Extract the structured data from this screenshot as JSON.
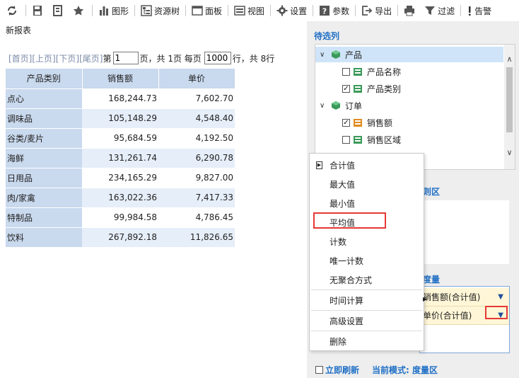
{
  "toolbar": {
    "refresh_icon": "refresh-icon",
    "save_icon": "save-icon",
    "save_as_icon": "save-as-icon",
    "favorite_icon": "star-icon",
    "chart_label": "图形",
    "resource_tree_label": "资源树",
    "panel_label": "面板",
    "view_label": "视图",
    "settings_label": "设置",
    "params_label": "参数",
    "export_label": "导出",
    "print_icon": "print-icon",
    "filter_label": "过滤",
    "alert_label": "告警"
  },
  "report": {
    "title": "新报表"
  },
  "pager": {
    "first": "[首页]",
    "prev": "[上页]",
    "next": "[下页]",
    "last": "[尾页]",
    "page_prefix": "第",
    "page_value": "1",
    "page_suffix": "页，共 1页 每页",
    "page_size_value": "1000",
    "rows_suffix": "行，共 8行"
  },
  "table": {
    "headers": [
      "产品类别",
      "销售额",
      "单价"
    ],
    "rows": [
      [
        "点心",
        "168,244.73",
        "7,602.70"
      ],
      [
        "调味品",
        "105,148.29",
        "4,548.40"
      ],
      [
        "谷类/麦片",
        "95,684.59",
        "4,192.50"
      ],
      [
        "海鲜",
        "131,261.74",
        "6,290.78"
      ],
      [
        "日用品",
        "234,165.29",
        "9,827.00"
      ],
      [
        "肉/家禽",
        "163,022.36",
        "7,417.33"
      ],
      [
        "特制品",
        "99,984.58",
        "4,786.45"
      ],
      [
        "饮料",
        "267,892.18",
        "11,826.65"
      ]
    ]
  },
  "panel": {
    "candidates_title": "待选列",
    "tree": [
      {
        "label": "产品",
        "expanded": true,
        "selected": true
      },
      {
        "label": "产品名称",
        "checked": false
      },
      {
        "label": "产品类别",
        "checked": true
      },
      {
        "label": "订单",
        "expanded": true
      },
      {
        "label": "销售额",
        "checked": true
      },
      {
        "label": "销售区域",
        "checked": false
      }
    ],
    "region_title_fragment": "则区",
    "measure_title_fragment": "度量",
    "measures": [
      "销售额(合计值)",
      "单价(合计值)"
    ],
    "instant_refresh": "立即刷新",
    "current_mode": "当前模式: 度量区"
  },
  "menu": {
    "items": [
      "合计值",
      "最大值",
      "最小值",
      "平均值",
      "计数",
      "唯一计数",
      "无聚合方式",
      "时间计算",
      "高级设置",
      "删除"
    ]
  },
  "colors": {
    "accent_blue": "#1f6fc5",
    "header_bg": "#c9d9ee",
    "highlight_red": "#e53935",
    "measure_row_bg": "#fff6d7"
  }
}
